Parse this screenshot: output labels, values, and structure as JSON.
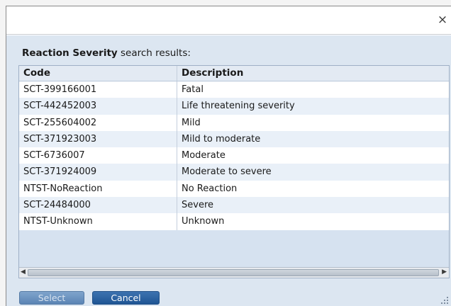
{
  "dialog": {
    "close_glyph": "×",
    "heading_strong": "Reaction Severity",
    "heading_rest": " search results:"
  },
  "table": {
    "columns": [
      "Code",
      "Description"
    ],
    "rows": [
      {
        "code": "SCT-399166001",
        "description": "Fatal"
      },
      {
        "code": "SCT-442452003",
        "description": "Life threatening severity"
      },
      {
        "code": "SCT-255604002",
        "description": "Mild"
      },
      {
        "code": "SCT-371923003",
        "description": "Mild to moderate"
      },
      {
        "code": "SCT-6736007",
        "description": "Moderate"
      },
      {
        "code": "SCT-371924009",
        "description": "Moderate to severe"
      },
      {
        "code": "NTST-NoReaction",
        "description": "No Reaction"
      },
      {
        "code": "SCT-24484000",
        "description": "Severe"
      },
      {
        "code": "NTST-Unknown",
        "description": "Unknown"
      }
    ]
  },
  "scrollbar": {
    "left_arrow": "◀",
    "right_arrow": "▶"
  },
  "buttons": {
    "select_label": "Select",
    "cancel_label": "Cancel"
  },
  "colors": {
    "accent": "#1f5594",
    "panel": "#dce6f1",
    "row_alt": "#e9f0f8"
  }
}
